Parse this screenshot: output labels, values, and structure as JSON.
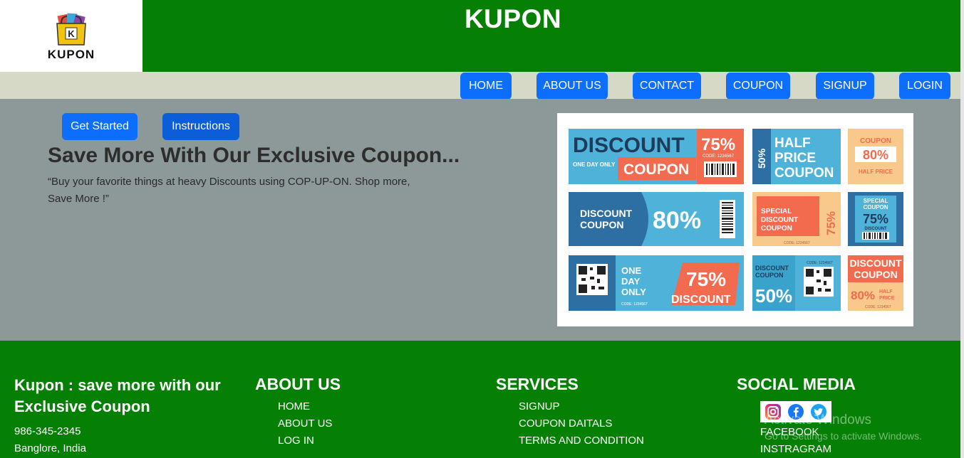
{
  "header": {
    "logo_text": "KUPON",
    "logo_letter": "K",
    "site_title": "KUPON"
  },
  "nav": {
    "items": [
      {
        "label": "HOME"
      },
      {
        "label": "ABOUT US"
      },
      {
        "label": "CONTACT"
      },
      {
        "label": "COUPON"
      },
      {
        "label": "SIGNUP"
      },
      {
        "label": "LOGIN"
      }
    ],
    "button_color": "#0d6efd"
  },
  "hero": {
    "get_started_label": "Get Started",
    "instructions_label": "Instructions",
    "heading": "Save More With Our Exclusive Coupon...",
    "text": "“Buy your favorite things at heavy Discounts using COP-UP-ON. Shop more, Save More !”",
    "coupon_image": {
      "c1": {
        "big": "DISCOUNT",
        "small": "ONE DAY ONLY",
        "word": "COUPON",
        "pct": "75%",
        "code": "CODE: 1234567"
      },
      "c2": {
        "side": "50%",
        "line1": "HALF",
        "line2": "PRICE",
        "line3": "COUPON"
      },
      "c3": {
        "top": "COUPON",
        "pct": "80%",
        "bottom": "HALF PRICE"
      },
      "c4": {
        "line1": "DISCOUNT",
        "line2": "COUPON",
        "pct": "80%"
      },
      "c5": {
        "line1": "SPECIAL",
        "line2": "DISCOUNT",
        "line3": "COUPON",
        "pct": "75%",
        "code": "CODE: 1234567"
      },
      "c6": {
        "line1": "SPECIAL",
        "line2": "COUPON",
        "pct": "75%",
        "bottom": "DISCOUNT"
      },
      "c7": {
        "line1": "ONE",
        "line2": "DAY",
        "line3": "ONLY",
        "pct": "75%",
        "word": "DISCOUNT",
        "code": "CODE: 1234567"
      },
      "c8": {
        "line1": "DISCOUNT",
        "line2": "COUPON",
        "pct": "50%",
        "code": "CODE: 1234567"
      },
      "c9": {
        "line1": "DISCOUNT",
        "line2": "COUPON",
        "pct": "80%",
        "half1": "HALF",
        "half2": "PRICE",
        "code": "CODE: 1234567"
      }
    }
  },
  "footer": {
    "brand": "Kupon : save more with our Exclusive Coupon",
    "phone": "986-345-2345",
    "location": "Banglore, India",
    "about": {
      "heading": "ABOUT US",
      "links": [
        "HOME",
        "ABOUT US",
        "LOG IN"
      ]
    },
    "services": {
      "heading": "SERVICES",
      "links": [
        "SIGNUP",
        "COUPON DAITALS",
        "TERMS AND CONDITION"
      ]
    },
    "social": {
      "heading": "SOCIAL MEDIA",
      "icons": [
        "instagram-icon",
        "facebook-icon",
        "twitter-icon"
      ],
      "links": [
        "FACEBOOK",
        "INSTRAGRAM"
      ]
    }
  },
  "watermark": {
    "line1": "Activate Windows",
    "line2": "Go to Settings to activate Windows."
  },
  "colors": {
    "header_green": "#058005",
    "nav_bar": "#d6d9c6",
    "hero_bg": "#8d9899",
    "button_blue": "#0d6efd"
  }
}
